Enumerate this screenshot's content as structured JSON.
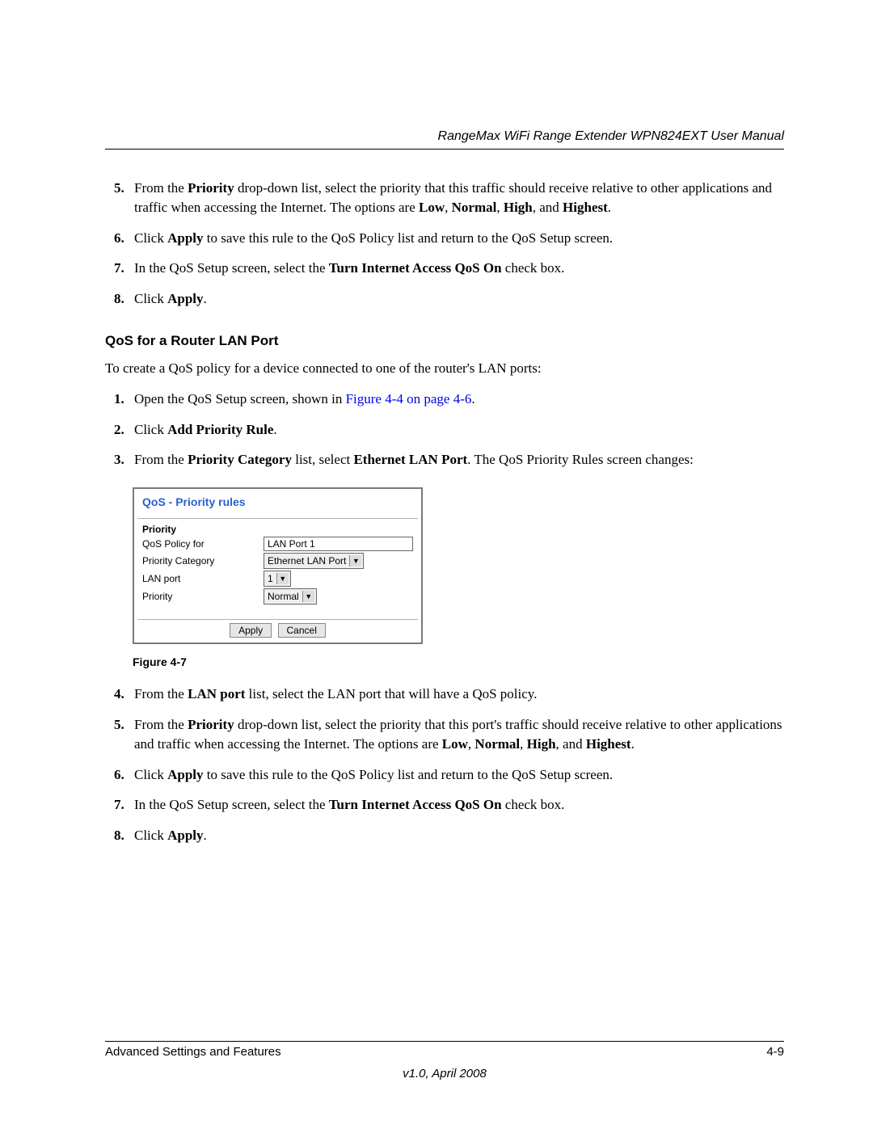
{
  "header": {
    "title": "RangeMax WiFi Range Extender WPN824EXT User Manual"
  },
  "list1": {
    "start": 5,
    "items": [
      {
        "html": "From the <b>Priority</b> drop-down list, select the priority that this traffic should receive relative to other applications and traffic when accessing the Internet. The options are <b>Low</b>, <b>Normal</b>, <b>High</b>, and <b>Highest</b>."
      },
      {
        "html": "Click <b>Apply</b> to save this rule to the QoS Policy list and return to the QoS Setup screen."
      },
      {
        "html": "In the QoS Setup screen, select the <b>Turn Internet Access QoS On</b> check box."
      },
      {
        "html": "Click <b>Apply</b>."
      }
    ]
  },
  "section": {
    "heading": "QoS for a Router LAN Port",
    "intro": "To create a QoS policy for a device connected to one of the router's LAN ports:"
  },
  "list2": {
    "start": 1,
    "items": [
      {
        "html": "Open the QoS Setup screen, shown in <span class='link'>Figure 4-4 on page 4-6</span>."
      },
      {
        "html": "Click <b>Add Priority Rule</b>."
      },
      {
        "html": "From the <b>Priority Category</b> list, select <b>Ethernet LAN Port</b>. The QoS Priority Rules screen changes:"
      }
    ]
  },
  "figure": {
    "title": "QoS - Priority rules",
    "section_label": "Priority",
    "rows": {
      "policy_for_label": "QoS Policy for",
      "policy_for_value": "LAN Port 1",
      "category_label": "Priority Category",
      "category_value": "Ethernet LAN Port",
      "lanport_label": "LAN port",
      "lanport_value": "1",
      "priority_label": "Priority",
      "priority_value": "Normal"
    },
    "buttons": {
      "apply": "Apply",
      "cancel": "Cancel"
    },
    "caption": "Figure 4-7"
  },
  "list3": {
    "start": 4,
    "items": [
      {
        "html": "From the <b>LAN port</b> list, select the LAN port that will have a QoS policy."
      },
      {
        "html": "From the <b>Priority</b> drop-down list, select the priority that this port's traffic should receive relative to other applications and traffic when accessing the Internet. The options are <b>Low</b>, <b>Normal</b>, <b>High</b>, and <b>Highest</b>."
      },
      {
        "html": "Click <b>Apply</b> to save this rule to the QoS Policy list and return to the QoS Setup screen."
      },
      {
        "html": "In the QoS Setup screen, select the <b>Turn Internet Access QoS On</b> check box."
      },
      {
        "html": "Click <b>Apply</b>."
      }
    ]
  },
  "footer": {
    "left": "Advanced Settings and Features",
    "right": "4-9",
    "version": "v1.0, April 2008"
  }
}
